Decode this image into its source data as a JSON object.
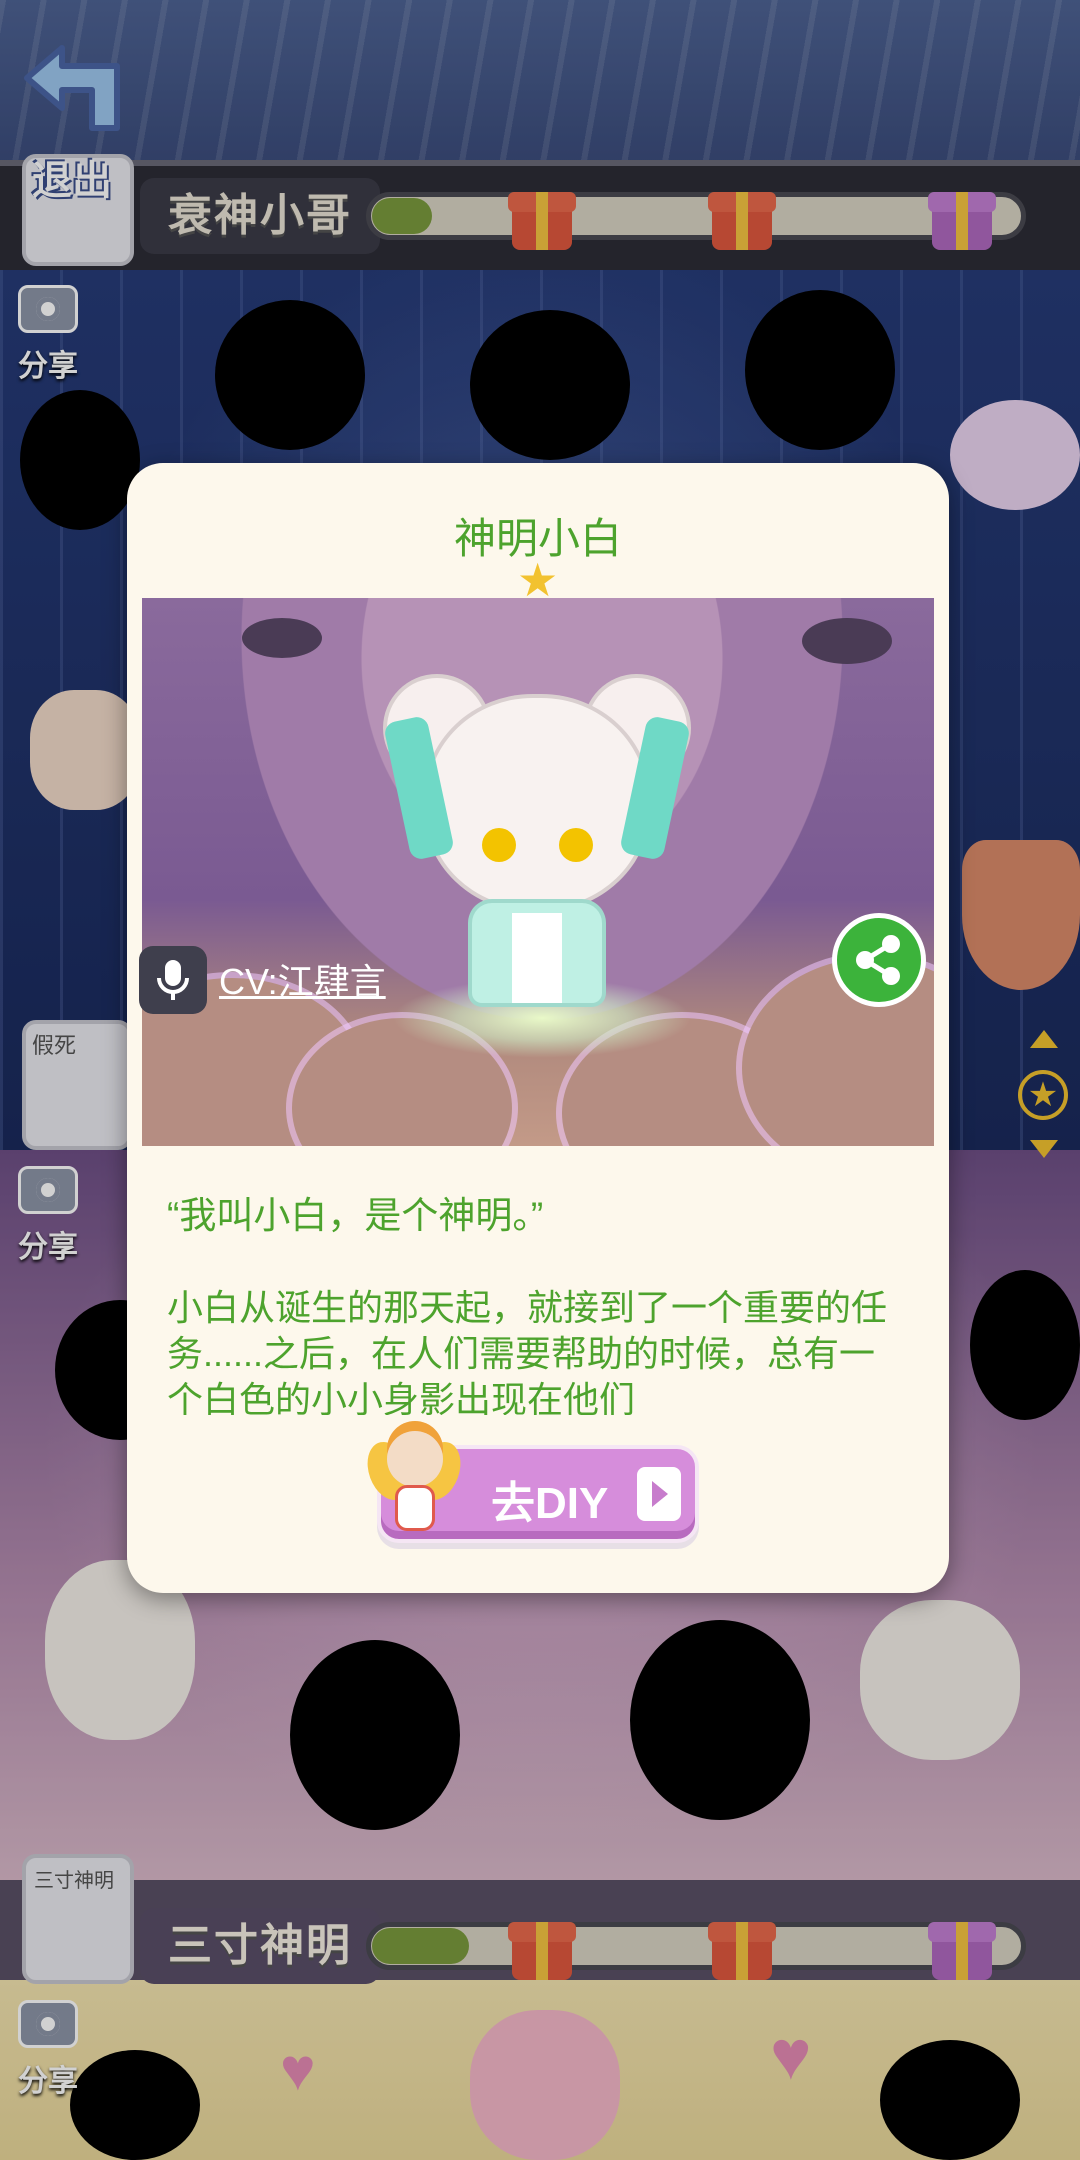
{
  "top_bar": {
    "exit_label": "退出",
    "character_name": "衰神小哥",
    "progress_fraction": 0.08
  },
  "share_label": "分享",
  "lower_bar": {
    "character_name": "三寸神明",
    "avatar_caption": "三寸神明",
    "progress_fraction": 0.15
  },
  "middle_card_caption": "假死",
  "modal": {
    "title": "神明小白",
    "stars": 1,
    "cv_label": "CV:江肆言",
    "quote": "“我叫小白，是个神明。”",
    "description": "小白从诞生的那天起，就接到了一个重要的任务......之后，在人们需要帮助的时候，总有一个白色的小小身影出现在他们",
    "diy_button": "去DIY"
  },
  "colors": {
    "accent_green": "#4da32d",
    "diy_pink": "#d68ddb",
    "progress_green": "#7a9a3d"
  }
}
